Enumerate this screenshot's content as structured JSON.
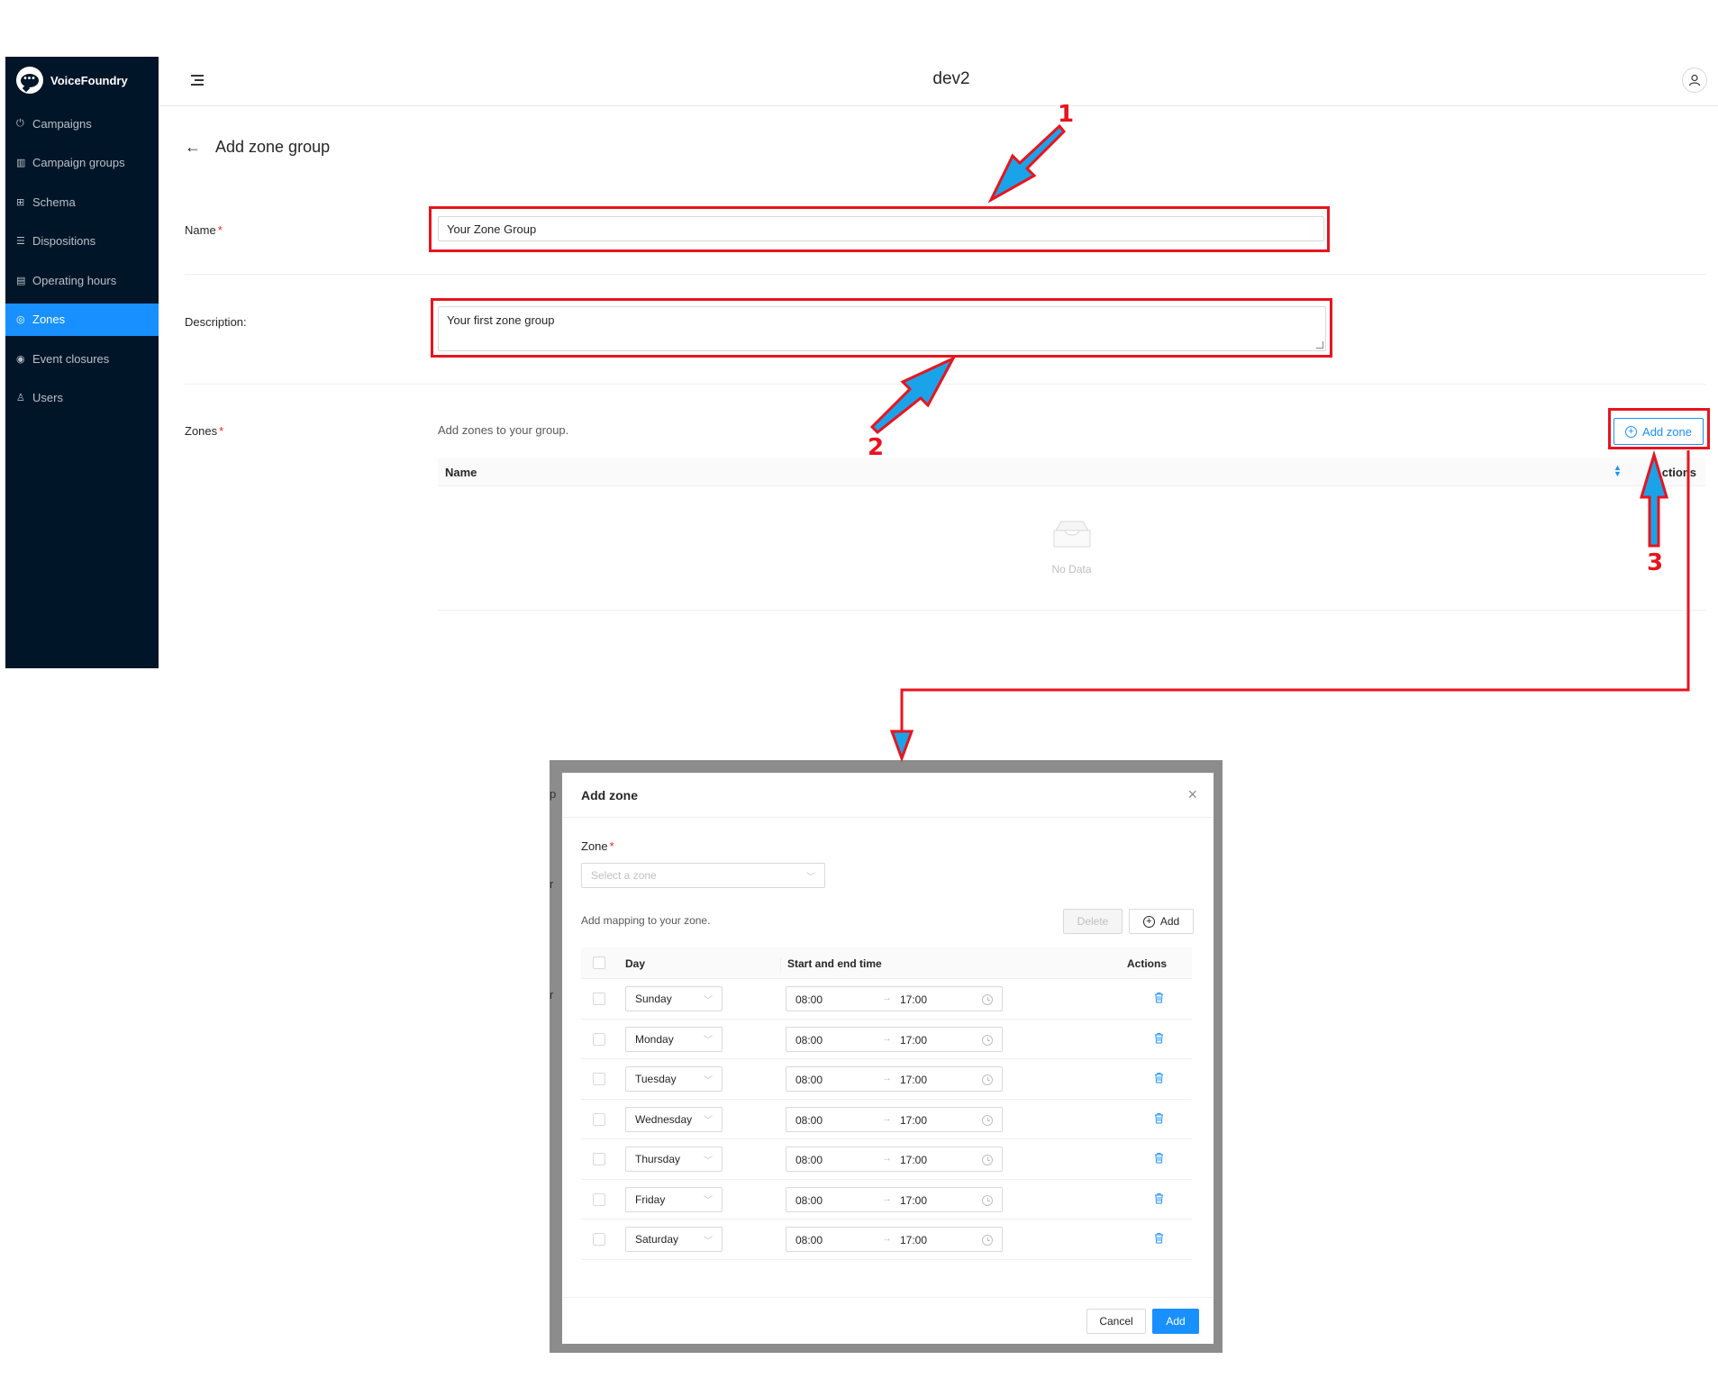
{
  "brand": {
    "name": "VoiceFoundry"
  },
  "sidebar": {
    "items": [
      {
        "label": "Campaigns",
        "icon": "power-icon"
      },
      {
        "label": "Campaign groups",
        "icon": "campaign-groups-icon"
      },
      {
        "label": "Schema",
        "icon": "table-icon"
      },
      {
        "label": "Dispositions",
        "icon": "list-icon"
      },
      {
        "label": "Operating hours",
        "icon": "calendar-icon"
      },
      {
        "label": "Zones",
        "icon": "pin-icon",
        "active": true
      },
      {
        "label": "Event closures",
        "icon": "target-icon"
      },
      {
        "label": "Users",
        "icon": "user-icon"
      }
    ]
  },
  "header": {
    "title": "dev2"
  },
  "page": {
    "title": "Add zone group",
    "name_label": "Name",
    "name_value": "Your Zone Group",
    "description_label": "Description:",
    "description_value": "Your first zone group",
    "zones_label": "Zones",
    "zones_hint": "Add zones to your group.",
    "add_zone_label": "Add zone",
    "table": {
      "col_name": "Name",
      "col_actions": "Actions",
      "empty_text": "No Data"
    }
  },
  "annotations": {
    "step1": "1",
    "step2": "2",
    "step3": "3"
  },
  "modal": {
    "title": "Add zone",
    "zone_label": "Zone",
    "zone_placeholder": "Select a zone",
    "mapping_hint": "Add mapping to your zone.",
    "delete_label": "Delete",
    "add_mapping_label": "Add",
    "columns": {
      "day": "Day",
      "time": "Start and end time",
      "actions": "Actions"
    },
    "rows": [
      {
        "day": "Sunday",
        "start": "08:00",
        "end": "17:00"
      },
      {
        "day": "Monday",
        "start": "08:00",
        "end": "17:00"
      },
      {
        "day": "Tuesday",
        "start": "08:00",
        "end": "17:00"
      },
      {
        "day": "Wednesday",
        "start": "08:00",
        "end": "17:00"
      },
      {
        "day": "Thursday",
        "start": "08:00",
        "end": "17:00"
      },
      {
        "day": "Friday",
        "start": "08:00",
        "end": "17:00"
      },
      {
        "day": "Saturday",
        "start": "08:00",
        "end": "17:00"
      }
    ],
    "cancel_label": "Cancel",
    "submit_label": "Add"
  },
  "colors": {
    "sidebar": "#011529",
    "accent": "#1890ff",
    "annotation": "#e8141e",
    "arrow_fill": "#1aa3e8"
  }
}
